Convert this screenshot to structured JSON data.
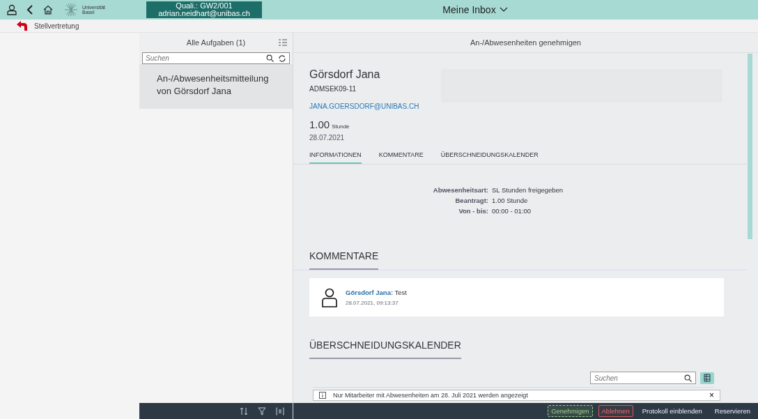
{
  "header": {
    "title": "Meine Inbox",
    "user": {
      "line1": "Quali.: GW2/001",
      "line2": "adrian.neidhart@unibas.ch"
    },
    "logo": {
      "line1": "Universität",
      "line2": "Basel"
    }
  },
  "breadcrumb": "Stellvertretung",
  "master": {
    "title": "Alle Aufgaben (1)",
    "search": {
      "placeholder": "Suchen"
    },
    "items": [
      {
        "title": "An-/Abwesenheitsmitteilung von Görsdorf Jana",
        "selected": true
      }
    ]
  },
  "detail": {
    "title": "An-/Abwesenheiten genehmigen",
    "name": "Görsdorf Jana",
    "id": "ADMSEK09-11",
    "email": "JANA.GOERSDORF@UNIBAS.CH",
    "amount": "1.00",
    "unit": "Stunde",
    "date": "28.07.2021",
    "tabs": [
      {
        "label": "INFORMATIONEN",
        "selected": true
      },
      {
        "label": "KOMMENTARE",
        "selected": false
      },
      {
        "label": "ÜBERSCHNEIDUNGSKALENDER",
        "selected": false
      }
    ],
    "info": [
      {
        "label": "Abwesenheitsart:",
        "value": "SL Stunden freigegeben"
      },
      {
        "label": "Beantragt:",
        "value": "1.00 Stunde"
      },
      {
        "label": "Von - bis:",
        "value": "00:00 - 01:00"
      }
    ],
    "comments_heading": "KOMMENTARE",
    "comments": [
      {
        "author": "Görsdorf Jana:",
        "text": "Test",
        "time": "28.07.2021, 09:13:37"
      }
    ],
    "calendar_heading": "ÜBERSCHNEIDUNGSKALENDER",
    "calendar_search": {
      "placeholder": "Suchen"
    },
    "notice": {
      "text": "Nur Mitarbeiter mit Abwesenheiten am 28. Juli 2021 werden angezeigt",
      "close": "×"
    }
  },
  "footer": {
    "buttons": [
      {
        "label": "Genehmigen",
        "kind": "accept"
      },
      {
        "label": "Ablehnen",
        "kind": "reject"
      },
      {
        "label": "Protokoll einblenden",
        "kind": "plain"
      },
      {
        "label": "Reservieren",
        "kind": "plain"
      }
    ]
  }
}
